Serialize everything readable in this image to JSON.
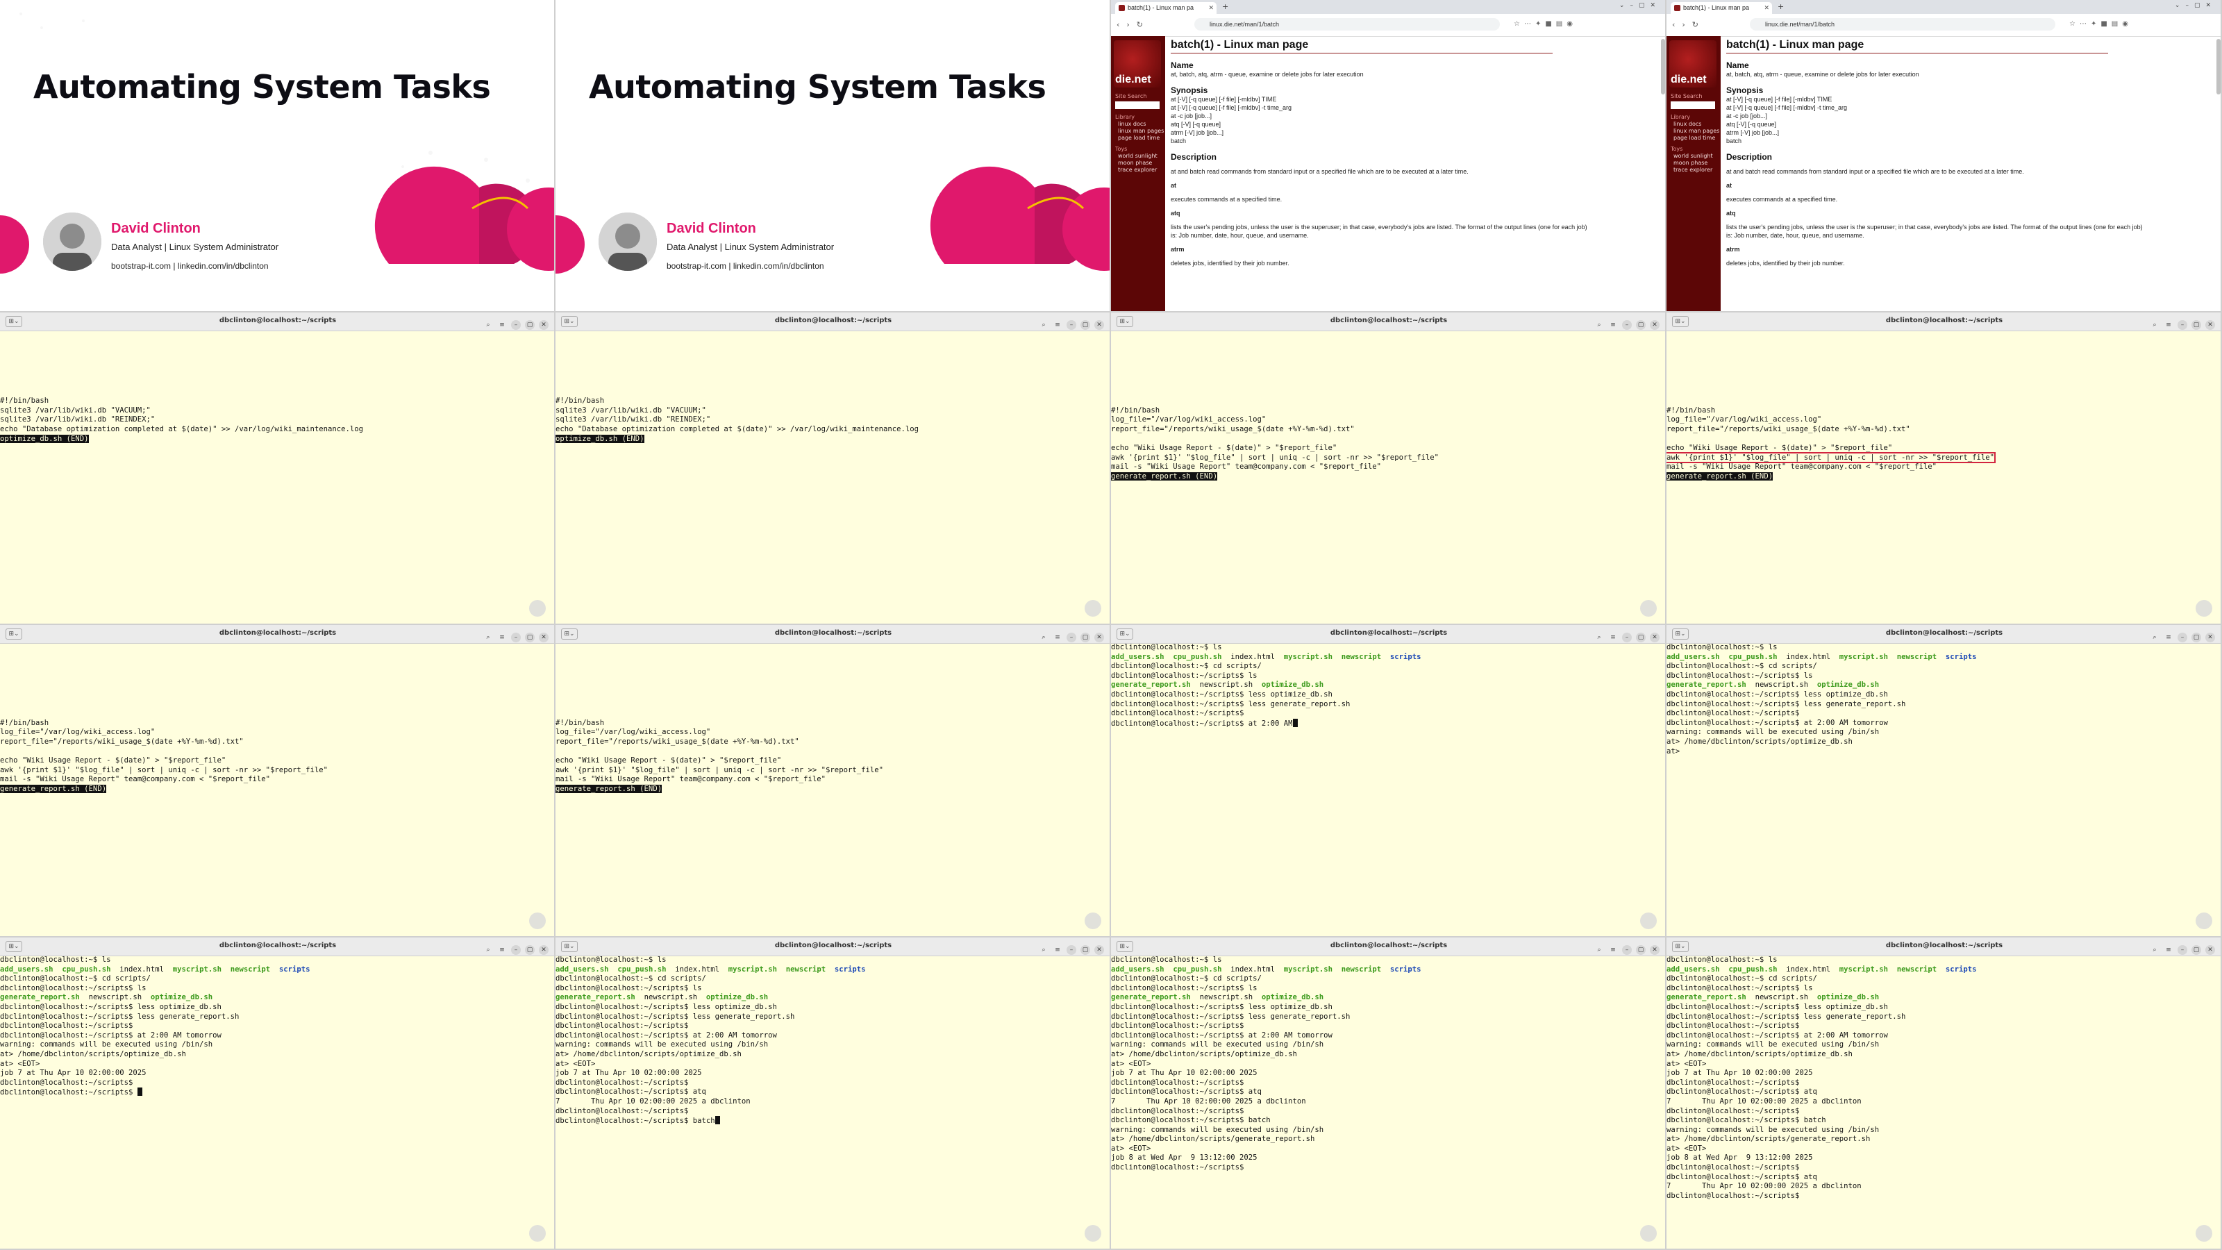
{
  "slides": [
    {
      "title": "Automating System Tasks",
      "presenter_name": "David Clinton",
      "presenter_role": "Data Analyst | Linux System Administrator",
      "presenter_links": "bootstrap-it.com | linkedin.com/in/dbclinton"
    },
    {
      "title": "Automating System Tasks",
      "presenter_name": "David Clinton",
      "presenter_role": "Data Analyst | Linux System Administrator",
      "presenter_links": "bootstrap-it.com | linkedin.com/in/dbclinton"
    }
  ],
  "browser": {
    "tab_title": "batch(1) - Linux man pa",
    "url": "linux.die.net/man/1/batch",
    "logo_text": "die.net",
    "site_search": "Site Search",
    "library_heading": "Library",
    "library_items": [
      "linux docs",
      "linux man pages",
      "page load time"
    ],
    "toys_heading": "Toys",
    "toys_items": [
      "world sunlight",
      "moon phase",
      "trace explorer"
    ],
    "page_title": "batch(1) - Linux man page",
    "name_heading": "Name",
    "name_text": "at, batch, atq, atrm - queue, examine or delete jobs for later execution",
    "synopsis_heading": "Synopsis",
    "synopsis_lines": [
      "at [-V] [-q queue] [-f file] [-mldbv] TIME",
      "at [-V] [-q queue] [-f file] [-mldbv] -t time_arg",
      "at -c job [job...]",
      "atq [-V] [-q queue]",
      "atrm [-V] job [job...]",
      "batch"
    ],
    "description_heading": "Description",
    "description_intro": "at and batch read commands from standard input or a specified file which are to be executed at a later time.",
    "desc_at_term": "at",
    "desc_at_text": "executes commands at a specified time.",
    "desc_atq_term": "atq",
    "desc_atq_text": "lists the user's pending jobs, unless the user is the superuser; in that case, everybody's jobs are listed. The format of the output lines (one for each job) is: Job number, date, hour, queue, and username.",
    "desc_atrm_term": "atrm",
    "desc_atrm_text": "deletes jobs, identified by their job number."
  },
  "terminal": {
    "title": "dbclinton@localhost:~/scripts"
  },
  "terminals": [
    {
      "lines": [
        {
          "t": ""
        },
        {
          "t": ""
        },
        {
          "t": ""
        },
        {
          "t": ""
        },
        {
          "t": ""
        },
        {
          "t": ""
        },
        {
          "t": ""
        },
        {
          "t": "#!/bin/bash"
        },
        {
          "t": "sqlite3 /var/lib/wiki.db \"VACUUM;\""
        },
        {
          "t": "sqlite3 /var/lib/wiki.db \"REINDEX;\""
        },
        {
          "t": "echo \"Database optimization completed at $(date)\" >> /var/log/wiki_maintenance.log"
        },
        {
          "t": "optimize_db.sh (END)",
          "hl": true
        }
      ]
    },
    {
      "lines": [
        {
          "t": ""
        },
        {
          "t": ""
        },
        {
          "t": ""
        },
        {
          "t": ""
        },
        {
          "t": ""
        },
        {
          "t": ""
        },
        {
          "t": ""
        },
        {
          "t": "#!/bin/bash"
        },
        {
          "t": "sqlite3 /var/lib/wiki.db \"VACUUM;\""
        },
        {
          "t": "sqlite3 /var/lib/wiki.db \"REINDEX;\""
        },
        {
          "t": "echo \"Database optimization completed at $(date)\" >> /var/log/wiki_maintenance.log"
        },
        {
          "t": "optimize_db.sh (END)",
          "hl": true
        }
      ]
    },
    {
      "lines": [
        {
          "t": ""
        },
        {
          "t": ""
        },
        {
          "t": ""
        },
        {
          "t": ""
        },
        {
          "t": ""
        },
        {
          "t": ""
        },
        {
          "t": ""
        },
        {
          "t": ""
        },
        {
          "t": "#!/bin/bash"
        },
        {
          "t": "log_file=\"/var/log/wiki_access.log\""
        },
        {
          "t": "report_file=\"/reports/wiki_usage_$(date +%Y-%m-%d).txt\""
        },
        {
          "t": ""
        },
        {
          "t": "echo \"Wiki Usage Report - $(date)\" > \"$report_file\""
        },
        {
          "t": "awk '{print $1}' \"$log_file\" | sort | uniq -c | sort -nr >> \"$report_file\""
        },
        {
          "t": "mail -s \"Wiki Usage Report\" team@company.com < \"$report_file\""
        },
        {
          "t": "generate_report.sh (END)",
          "hl": true
        }
      ]
    },
    {
      "lines": [
        {
          "t": ""
        },
        {
          "t": ""
        },
        {
          "t": ""
        },
        {
          "t": ""
        },
        {
          "t": ""
        },
        {
          "t": ""
        },
        {
          "t": ""
        },
        {
          "t": ""
        },
        {
          "t": "#!/bin/bash"
        },
        {
          "t": "log_file=\"/var/log/wiki_access.log\""
        },
        {
          "t": "report_file=\"/reports/wiki_usage_$(date +%Y-%m-%d).txt\""
        },
        {
          "t": ""
        },
        {
          "t": "echo \"Wiki Usage Report - $(date)\" > \"$report_file\""
        },
        {
          "t": "awk '{print $1}' \"$log_file\" | sort | uniq -c | sort -nr >> \"$report_file\"",
          "box": true
        },
        {
          "t": "mail -s \"Wiki Usage Report\" team@company.com < \"$report_file\""
        },
        {
          "t": "generate_report.sh (END)",
          "hl": true
        }
      ]
    },
    {
      "lines": [
        {
          "t": ""
        },
        {
          "t": ""
        },
        {
          "t": ""
        },
        {
          "t": ""
        },
        {
          "t": ""
        },
        {
          "t": ""
        },
        {
          "t": ""
        },
        {
          "t": ""
        },
        {
          "t": "#!/bin/bash"
        },
        {
          "t": "log_file=\"/var/log/wiki_access.log\""
        },
        {
          "t": "report_file=\"/reports/wiki_usage_$(date +%Y-%m-%d).txt\""
        },
        {
          "t": ""
        },
        {
          "t": "echo \"Wiki Usage Report - $(date)\" > \"$report_file\""
        },
        {
          "t": "awk '{print $1}' \"$log_file\" | sort | uniq -c | sort -nr >> \"$report_file\""
        },
        {
          "t": "mail -s \"Wiki Usage Report\" team@company.com < \"$report_file\""
        },
        {
          "t": "generate_report.sh (END)",
          "hl": true
        }
      ]
    },
    {
      "lines": [
        {
          "t": ""
        },
        {
          "t": ""
        },
        {
          "t": ""
        },
        {
          "t": ""
        },
        {
          "t": ""
        },
        {
          "t": ""
        },
        {
          "t": ""
        },
        {
          "t": ""
        },
        {
          "t": "#!/bin/bash"
        },
        {
          "t": "log_file=\"/var/log/wiki_access.log\""
        },
        {
          "t": "report_file=\"/reports/wiki_usage_$(date +%Y-%m-%d).txt\""
        },
        {
          "t": ""
        },
        {
          "t": "echo \"Wiki Usage Report - $(date)\" > \"$report_file\""
        },
        {
          "t": "awk '{print $1}' \"$log_file\" | sort | uniq -c | sort -nr >> \"$report_file\""
        },
        {
          "t": "mail -s \"Wiki Usage Report\" team@company.com < \"$report_file\""
        },
        {
          "t": "generate_report.sh (END)",
          "hl": true
        }
      ]
    },
    {
      "lines": [
        {
          "t": "dbclinton@localhost:~$ ls"
        },
        {
          "ls1": true
        },
        {
          "t": "dbclinton@localhost:~$ cd scripts/"
        },
        {
          "t": "dbclinton@localhost:~/scripts$ ls"
        },
        {
          "ls2": true
        },
        {
          "t": "dbclinton@localhost:~/scripts$ less optimize_db.sh"
        },
        {
          "t": "dbclinton@localhost:~/scripts$ less generate_report.sh"
        },
        {
          "t": "dbclinton@localhost:~/scripts$"
        },
        {
          "t": "dbclinton@localhost:~/scripts$ at 2:00 AM",
          "cursor": true
        }
      ]
    },
    {
      "lines": [
        {
          "t": "dbclinton@localhost:~$ ls"
        },
        {
          "ls1": true
        },
        {
          "t": "dbclinton@localhost:~$ cd scripts/"
        },
        {
          "t": "dbclinton@localhost:~/scripts$ ls"
        },
        {
          "ls2": true
        },
        {
          "t": "dbclinton@localhost:~/scripts$ less optimize_db.sh"
        },
        {
          "t": "dbclinton@localhost:~/scripts$ less generate_report.sh"
        },
        {
          "t": "dbclinton@localhost:~/scripts$"
        },
        {
          "t": "dbclinton@localhost:~/scripts$ at 2:00 AM tomorrow"
        },
        {
          "t": "warning: commands will be executed using /bin/sh"
        },
        {
          "t": "at> /home/dbclinton/scripts/optimize_db.sh"
        },
        {
          "t": "at>"
        }
      ]
    },
    {
      "lines": [
        {
          "t": "dbclinton@localhost:~$ ls"
        },
        {
          "ls1": true
        },
        {
          "t": "dbclinton@localhost:~$ cd scripts/"
        },
        {
          "t": "dbclinton@localhost:~/scripts$ ls"
        },
        {
          "ls2": true
        },
        {
          "t": "dbclinton@localhost:~/scripts$ less optimize_db.sh"
        },
        {
          "t": "dbclinton@localhost:~/scripts$ less generate_report.sh"
        },
        {
          "t": "dbclinton@localhost:~/scripts$"
        },
        {
          "t": "dbclinton@localhost:~/scripts$ at 2:00 AM tomorrow"
        },
        {
          "t": "warning: commands will be executed using /bin/sh"
        },
        {
          "t": "at> /home/dbclinton/scripts/optimize_db.sh"
        },
        {
          "t": "at> <EOT>"
        },
        {
          "t": "job 7 at Thu Apr 10 02:00:00 2025"
        },
        {
          "t": "dbclinton@localhost:~/scripts$"
        },
        {
          "t": "dbclinton@localhost:~/scripts$ ",
          "cursor": true
        }
      ]
    },
    {
      "lines": [
        {
          "t": "dbclinton@localhost:~$ ls"
        },
        {
          "ls1": true
        },
        {
          "t": "dbclinton@localhost:~$ cd scripts/"
        },
        {
          "t": "dbclinton@localhost:~/scripts$ ls"
        },
        {
          "ls2": true
        },
        {
          "t": "dbclinton@localhost:~/scripts$ less optimize_db.sh"
        },
        {
          "t": "dbclinton@localhost:~/scripts$ less generate_report.sh"
        },
        {
          "t": "dbclinton@localhost:~/scripts$"
        },
        {
          "t": "dbclinton@localhost:~/scripts$ at 2:00 AM tomorrow"
        },
        {
          "t": "warning: commands will be executed using /bin/sh"
        },
        {
          "t": "at> /home/dbclinton/scripts/optimize_db.sh"
        },
        {
          "t": "at> <EOT>"
        },
        {
          "t": "job 7 at Thu Apr 10 02:00:00 2025"
        },
        {
          "t": "dbclinton@localhost:~/scripts$"
        },
        {
          "t": "dbclinton@localhost:~/scripts$ atq"
        },
        {
          "t": "7       Thu Apr 10 02:00:00 2025 a dbclinton"
        },
        {
          "t": "dbclinton@localhost:~/scripts$"
        },
        {
          "t": "dbclinton@localhost:~/scripts$ batch",
          "cursor": true
        }
      ]
    },
    {
      "lines": [
        {
          "t": "dbclinton@localhost:~$ ls"
        },
        {
          "ls1": true
        },
        {
          "t": "dbclinton@localhost:~$ cd scripts/"
        },
        {
          "t": "dbclinton@localhost:~/scripts$ ls"
        },
        {
          "ls2": true
        },
        {
          "t": "dbclinton@localhost:~/scripts$ less optimize_db.sh"
        },
        {
          "t": "dbclinton@localhost:~/scripts$ less generate_report.sh"
        },
        {
          "t": "dbclinton@localhost:~/scripts$"
        },
        {
          "t": "dbclinton@localhost:~/scripts$ at 2:00 AM tomorrow"
        },
        {
          "t": "warning: commands will be executed using /bin/sh"
        },
        {
          "t": "at> /home/dbclinton/scripts/optimize_db.sh"
        },
        {
          "t": "at> <EOT>"
        },
        {
          "t": "job 7 at Thu Apr 10 02:00:00 2025"
        },
        {
          "t": "dbclinton@localhost:~/scripts$"
        },
        {
          "t": "dbclinton@localhost:~/scripts$ atq"
        },
        {
          "t": "7       Thu Apr 10 02:00:00 2025 a dbclinton"
        },
        {
          "t": "dbclinton@localhost:~/scripts$"
        },
        {
          "t": "dbclinton@localhost:~/scripts$ batch"
        },
        {
          "t": "warning: commands will be executed using /bin/sh"
        },
        {
          "t": "at> /home/dbclinton/scripts/generate_report.sh"
        },
        {
          "t": "at> <EOT>"
        },
        {
          "t": "job 8 at Wed Apr  9 13:12:00 2025"
        },
        {
          "t": "dbclinton@localhost:~/scripts$"
        }
      ]
    },
    {
      "lines": [
        {
          "t": "dbclinton@localhost:~$ ls"
        },
        {
          "ls1": true
        },
        {
          "t": "dbclinton@localhost:~$ cd scripts/"
        },
        {
          "t": "dbclinton@localhost:~/scripts$ ls"
        },
        {
          "ls2": true
        },
        {
          "t": "dbclinton@localhost:~/scripts$ less optimize_db.sh"
        },
        {
          "t": "dbclinton@localhost:~/scripts$ less generate_report.sh"
        },
        {
          "t": "dbclinton@localhost:~/scripts$"
        },
        {
          "t": "dbclinton@localhost:~/scripts$ at 2:00 AM tomorrow"
        },
        {
          "t": "warning: commands will be executed using /bin/sh"
        },
        {
          "t": "at> /home/dbclinton/scripts/optimize_db.sh"
        },
        {
          "t": "at> <EOT>"
        },
        {
          "t": "job 7 at Thu Apr 10 02:00:00 2025"
        },
        {
          "t": "dbclinton@localhost:~/scripts$"
        },
        {
          "t": "dbclinton@localhost:~/scripts$ atq"
        },
        {
          "t": "7       Thu Apr 10 02:00:00 2025 a dbclinton"
        },
        {
          "t": "dbclinton@localhost:~/scripts$"
        },
        {
          "t": "dbclinton@localhost:~/scripts$ batch"
        },
        {
          "t": "warning: commands will be executed using /bin/sh"
        },
        {
          "t": "at> /home/dbclinton/scripts/generate_report.sh"
        },
        {
          "t": "at> <EOT>"
        },
        {
          "t": "job 8 at Wed Apr  9 13:12:00 2025"
        },
        {
          "t": "dbclinton@localhost:~/scripts$"
        },
        {
          "t": "dbclinton@localhost:~/scripts$ atq"
        },
        {
          "t": "7       Thu Apr 10 02:00:00 2025 a dbclinton"
        },
        {
          "t": "dbclinton@localhost:~/scripts$"
        }
      ]
    }
  ],
  "ls_home": [
    {
      "name": "add_users.sh",
      "kind": "exec"
    },
    {
      "name": "cpu_push.sh",
      "kind": "exec"
    },
    {
      "name": "index.html",
      "kind": "plain"
    },
    {
      "name": "myscript.sh",
      "kind": "exec"
    },
    {
      "name": "newscript",
      "kind": "exec"
    },
    {
      "name": "scripts",
      "kind": "dir"
    }
  ],
  "ls_scripts": [
    {
      "name": "generate_report.sh",
      "kind": "exec"
    },
    {
      "name": "newscript.sh",
      "kind": "plain"
    },
    {
      "name": "optimize_db.sh",
      "kind": "exec"
    }
  ],
  "colors": {
    "terminal_bg": "#fffede",
    "exec_green": "#3c9a1c",
    "dir_blue": "#1d49b6",
    "accent_pink": "#e0186c",
    "dienet_maroon": "#5c0606"
  }
}
